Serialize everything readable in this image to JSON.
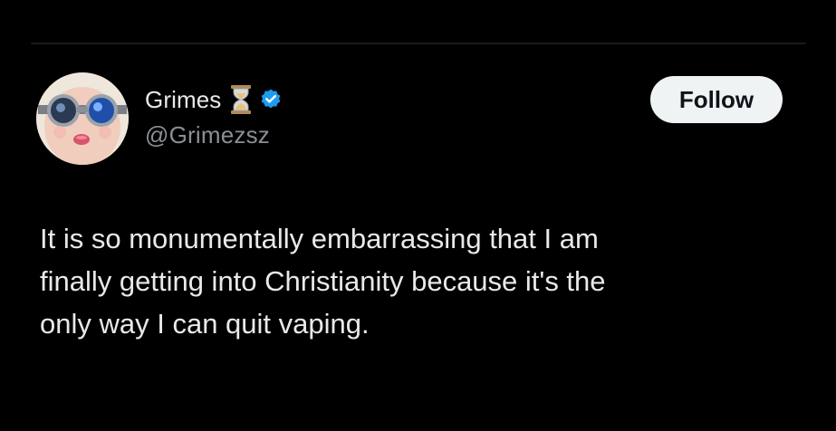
{
  "tweet": {
    "author": {
      "display_name": "Grimes",
      "handle": "@Grimezsz",
      "emoji_icon": "hourglass-icon",
      "verified_icon": "verified-badge-icon"
    },
    "follow_label": "Follow",
    "text": "It is so monumentally embarrassing that I am\nfinally getting into Christianity because it's the\nonly way I can quit vaping."
  },
  "colors": {
    "background": "#000000",
    "text_primary": "#e7e9ea",
    "text_secondary": "#8b8f94",
    "verified_blue": "#1d9bf0",
    "follow_bg": "#eff3f4"
  }
}
